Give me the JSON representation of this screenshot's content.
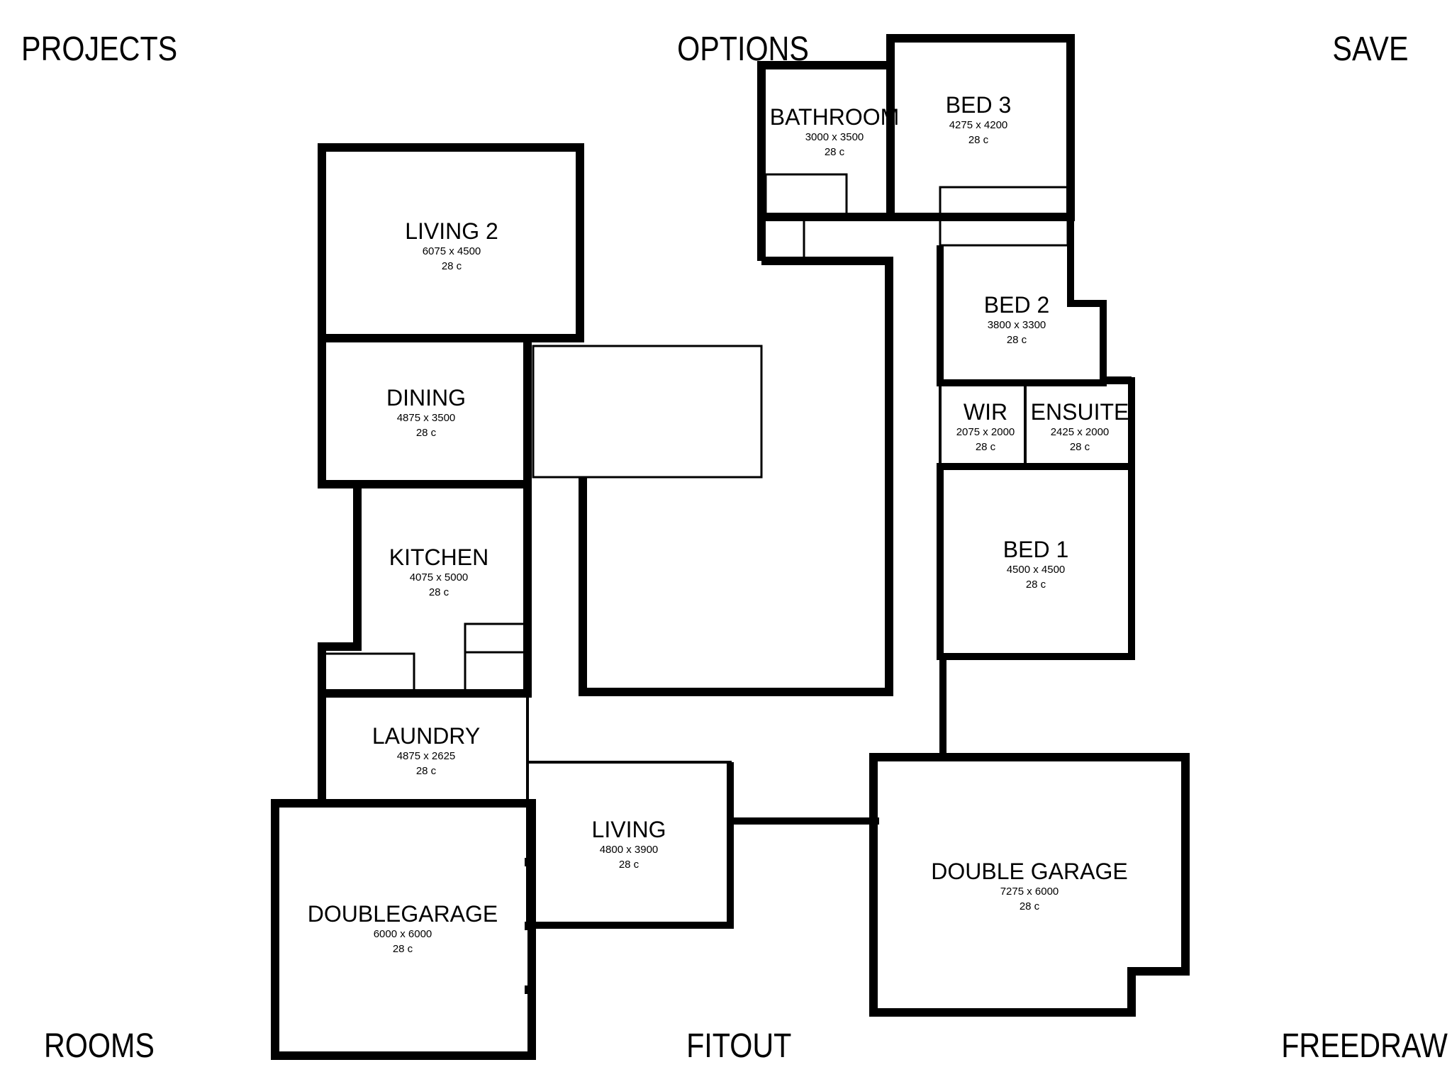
{
  "menu": {
    "projects": "PROJECTS",
    "options": "OPTIONS",
    "save": "SAVE",
    "rooms": "ROOMS",
    "fitout": "FITOUT",
    "freedraw": "FREEDRAW"
  },
  "rooms": {
    "living2": {
      "name": "LIVING 2",
      "dims": "6075 x 4500",
      "c": "28 c"
    },
    "dining": {
      "name": "DINING",
      "dims": "4875 x 3500",
      "c": "28 c"
    },
    "kitchen": {
      "name": "KITCHEN",
      "dims": "4075 x 5000",
      "c": "28 c"
    },
    "laundry": {
      "name": "LAUNDRY",
      "dims": "4875 x 2625",
      "c": "28 c"
    },
    "doublegarage": {
      "name": "DOUBLEGARAGE",
      "dims": "6000 x 6000",
      "c": "28 c"
    },
    "living": {
      "name": "LIVING",
      "dims": "4800 x 3900",
      "c": "28 c"
    },
    "bathroom": {
      "name": "BATHROOM",
      "dims": "3000 x 3500",
      "c": "28 c"
    },
    "bed3": {
      "name": "BED 3",
      "dims": "4275 x 4200",
      "c": "28 c"
    },
    "bed2": {
      "name": "BED 2",
      "dims": "3800 x 3300",
      "c": "28 c"
    },
    "wir": {
      "name": "WIR",
      "dims": "2075 x 2000",
      "c": "28 c"
    },
    "ensuite": {
      "name": "ENSUITE",
      "dims": "2425 x 2000",
      "c": "28 c"
    },
    "bed1": {
      "name": "BED 1",
      "dims": "4500 x 4500",
      "c": "28 c"
    },
    "double_garage": {
      "name": "DOUBLE GARAGE",
      "dims": "7275 x 6000",
      "c": "28 c"
    }
  }
}
